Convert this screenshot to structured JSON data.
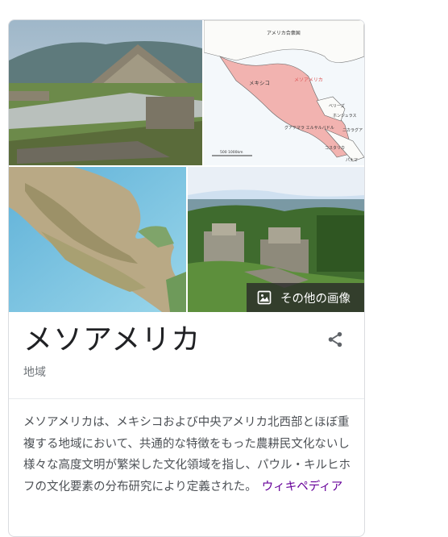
{
  "images": [
    {
      "alt": "pyramid-photo"
    },
    {
      "alt": "map-illustration"
    },
    {
      "alt": "relief-map"
    },
    {
      "alt": "ruins-photo"
    }
  ],
  "more_images_label": "その他の画像",
  "map_labels": {
    "top": "アメリカ合衆国",
    "mexico": "メキシコ",
    "mesoamerica": "メソアメリカ",
    "belize": "ベリーズ",
    "honduras": "ホンジュラス",
    "guatemala_elsalvador": "グアテマラ\nエルサルバドル",
    "nicaragua": "ニカラグア",
    "costarica": "コスタリカ",
    "panama": "パナマ",
    "scale": "500  1000km"
  },
  "entity": {
    "title": "メソアメリカ",
    "subtitle": "地域",
    "description": "メソアメリカは、メキシコおよび中央アメリカ北西部とほぼ重複する地域において、共通的な特徴をもった農耕民文化ないし様々な高度文明が繁栄した文化領域を指し、パウル・キルヒホフの文化要素の分布研究により定義された。",
    "source_link": "ウィキペディア"
  },
  "colors": {
    "link": "#660099",
    "text": "#4d5156",
    "title": "#202124",
    "subtle": "#70757a"
  },
  "icons": [
    "image-icon",
    "share-icon"
  ]
}
